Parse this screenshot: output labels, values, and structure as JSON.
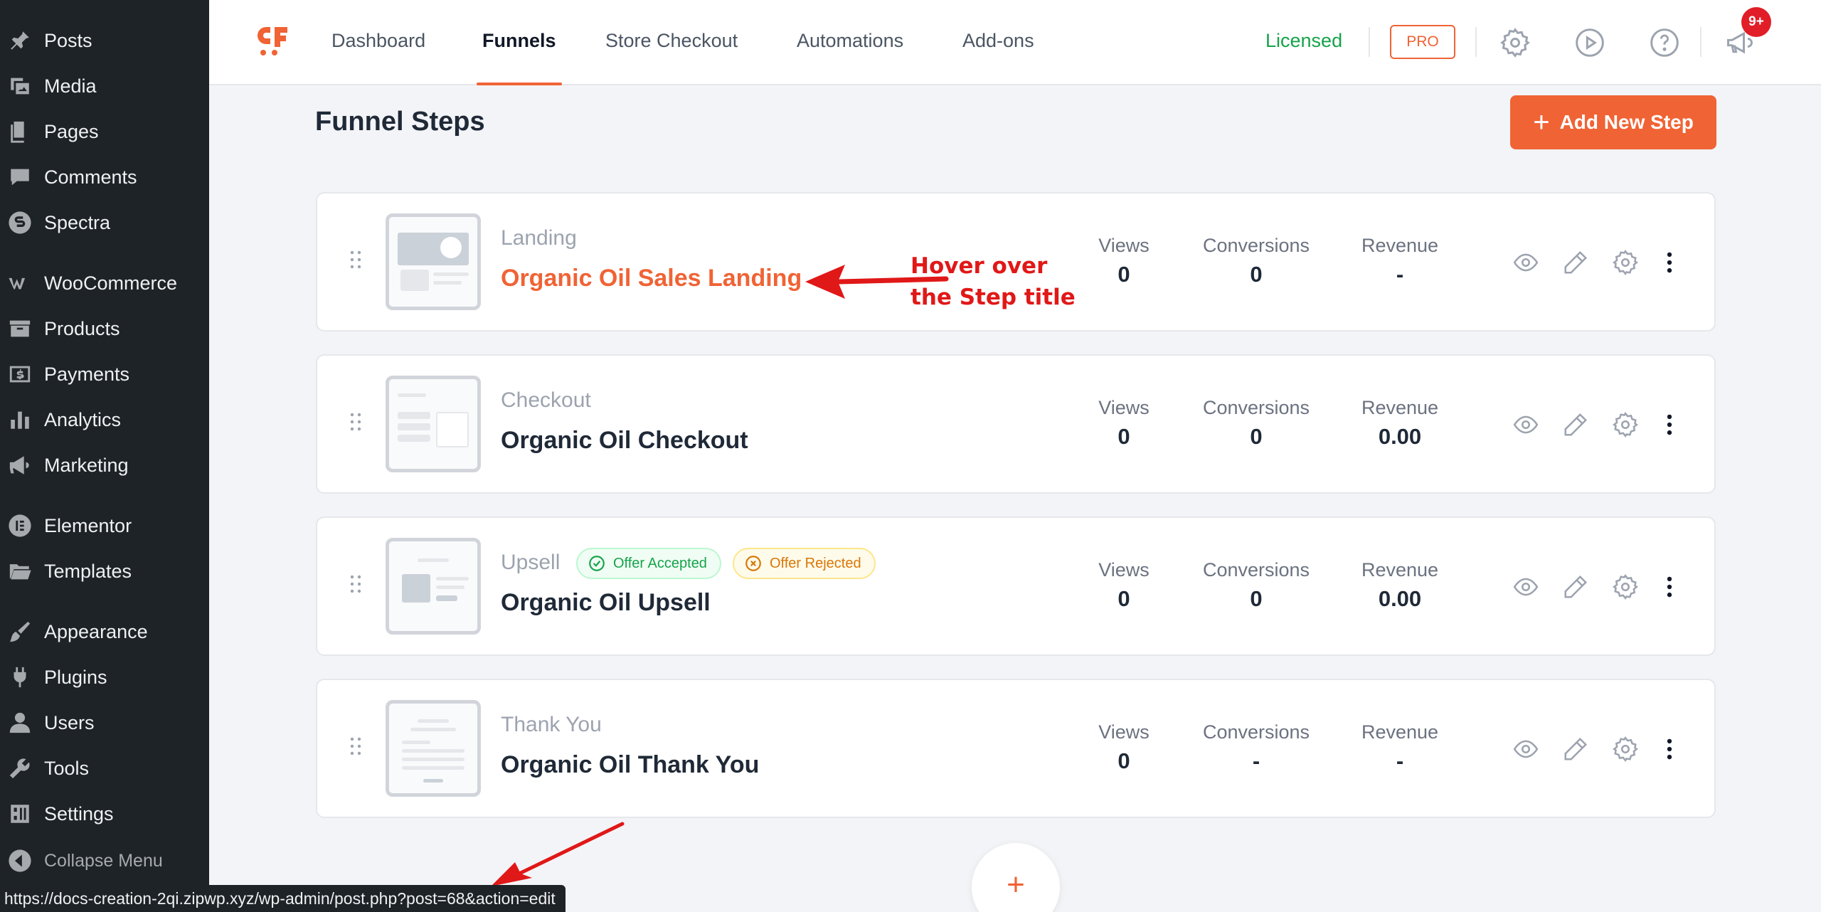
{
  "sidebar": {
    "items": [
      {
        "label": "Posts",
        "icon": "pin-icon"
      },
      {
        "label": "Media",
        "icon": "media-icon"
      },
      {
        "label": "Pages",
        "icon": "pages-icon"
      },
      {
        "label": "Comments",
        "icon": "comment-icon"
      },
      {
        "label": "Spectra",
        "icon": "spectra-icon"
      },
      {
        "label": "WooCommerce",
        "icon": "woo-icon"
      },
      {
        "label": "Products",
        "icon": "box-icon"
      },
      {
        "label": "Payments",
        "icon": "dollar-icon"
      },
      {
        "label": "Analytics",
        "icon": "bar-chart-icon"
      },
      {
        "label": "Marketing",
        "icon": "megaphone-icon"
      },
      {
        "label": "Elementor",
        "icon": "elementor-icon"
      },
      {
        "label": "Templates",
        "icon": "folder-icon"
      },
      {
        "label": "Appearance",
        "icon": "brush-icon"
      },
      {
        "label": "Plugins",
        "icon": "plug-icon"
      },
      {
        "label": "Users",
        "icon": "user-icon"
      },
      {
        "label": "Tools",
        "icon": "wrench-icon"
      },
      {
        "label": "Settings",
        "icon": "sliders-icon"
      }
    ],
    "collapse_label": "Collapse Menu"
  },
  "topnav": {
    "tabs": [
      {
        "label": "Dashboard",
        "active": false
      },
      {
        "label": "Funnels",
        "active": true
      },
      {
        "label": "Store Checkout",
        "active": false
      },
      {
        "label": "Automations",
        "active": false
      },
      {
        "label": "Add-ons",
        "active": false
      }
    ],
    "license_status": "Licensed",
    "pro_badge": "PRO",
    "notification_count": "9+"
  },
  "main": {
    "title": "Funnel Steps",
    "add_step_label": "Add New Step",
    "steps": [
      {
        "type": "Landing",
        "title": "Organic Oil Sales Landing",
        "views": "0",
        "conversions": "0",
        "revenue": "-",
        "hovered": true
      },
      {
        "type": "Checkout",
        "title": "Organic Oil Checkout",
        "views": "0",
        "conversions": "0",
        "revenue": "0.00"
      },
      {
        "type": "Upsell",
        "title": "Organic Oil Upsell",
        "views": "0",
        "conversions": "0",
        "revenue": "0.00"
      },
      {
        "type": "Thank You",
        "title": "Organic Oil Thank You",
        "views": "0",
        "conversions": "-",
        "revenue": "-"
      }
    ],
    "stat_labels": {
      "views": "Views",
      "conversions": "Conversions",
      "revenue": "Revenue"
    },
    "offer_badges": {
      "accepted": "Offer Accepted",
      "rejected": "Offer Rejected"
    },
    "add_plus": "+"
  },
  "annotation": {
    "line1": "Hover over",
    "line2": "the Step title",
    "color": "#e01818"
  },
  "status_bar": {
    "url": "https://docs-creation-2qi.zipwp.xyz/wp-admin/post.php?post=68&action=edit"
  },
  "colors": {
    "accent": "#f06335",
    "sidebar_bg": "#1d2327",
    "licensed_green": "#16a34a"
  }
}
